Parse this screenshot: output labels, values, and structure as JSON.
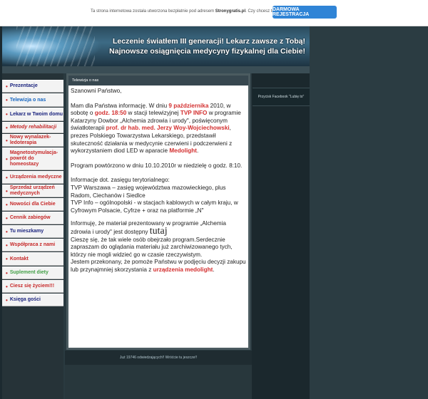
{
  "topbar": {
    "message_prefix": "Ta strona internetowa została utworzona bezpłatnie pod adresem ",
    "message_site": "Stronygratis.pl",
    "message_suffix": ". Czy chcesz też mieć własną stronę?",
    "register_label": "DARMOWA REJESTRACJA"
  },
  "banner": {
    "title": "Leczenie światłem III generacji! Lekarz zawsze z Tobą! Najnowsze osiągnięcia medycyny fizykalnej dla Ciebie!"
  },
  "nav": {
    "items": [
      {
        "label": "Prezentacje",
        "color": "#1a237e"
      },
      {
        "label": "Telewizja o nas",
        "color": "#1565c0"
      },
      {
        "label": "Lekarz w Twoim domu",
        "color": "#1a237e"
      },
      {
        "label": "Metody rehabilitacji",
        "color": "#c62828"
      },
      {
        "label": "Nowy wynalazek-ledoterapia",
        "color": "#c62828"
      },
      {
        "label": "Magnetostymulacja-powrót do homeostazy",
        "color": "#c62828"
      },
      {
        "label": "Urządzenia medyczne",
        "color": "#c62828"
      },
      {
        "label": "Sprzedaż urządzeń medycznych",
        "color": "#c62828"
      },
      {
        "label": "Nowości dla Ciebie",
        "color": "#c62828"
      },
      {
        "label": "Cennik zabiegów",
        "color": "#c62828"
      },
      {
        "label": "Tu mieszkamy",
        "color": "#1a237e"
      },
      {
        "label": "Współpraca z nami",
        "color": "#c62828"
      },
      {
        "label": "Kontakt",
        "color": "#c62828"
      },
      {
        "label": "Suplement diety",
        "color": "#43a047"
      },
      {
        "label": "Ciesz się życiem!!!",
        "color": "#c62828"
      },
      {
        "label": "Księga gości",
        "color": "#1a237e"
      }
    ]
  },
  "main": {
    "header": "Telewizja o nas",
    "greeting": "Szanowni Państwo,",
    "p1_a": "Mam dla Państwa informację. W dniu ",
    "p1_date": "9 października",
    "p1_b": " 2010, w sobotę o ",
    "p1_time": "godz. 18:50",
    "p1_c": " w stacji telewizyjnej ",
    "p1_tvp": "TVP INFO",
    "p1_d": " w programie Katarzyny Dowbor „Alchemia zdrowia i urody\", poświęconym światłoterapii ",
    "p1_prof": "prof. dr hab. med. Jerzy Woy-Wojciechowski",
    "p1_e": ", prezes Polskiego Towarzystwa Lekarskiego, przedstawił skuteczność działania w medycynie czerwieni i podczerwieni z wykorzystaniem diod LED w aparacie ",
    "p1_brand": "Medolight",
    "p1_end": ".",
    "p2": "Program powtórzono w dniu 10.10.2010r w niedzielę o godz. 8:10.",
    "p3_title": "Informacje dot. zasięgu terytorialnego:",
    "p3_a": "TVP Warszawa – zasięg województwa mazowieckiego, plus Radom, Ciechanów i Siedlce",
    "p3_b": "TVP Info – ogólnopolski - w stacjach kablowych w całym kraju, w Cyfrowym Polsacie, Cyfrze + oraz na platformie „N\"",
    "p4_a": "Informuję, że materiał prezentowany w programie „Alchemia zdrowia i urody\" jest dostępny ",
    "p4_big": "tutaj",
    "p5": "Cieszę się, że tak wiele osób obejrzało program.Serdecznie zapraszam do oglądania materiału już zarchiwizowanego tych, którzy nie mogli widzieć go w czasie rzeczywistym.",
    "p6_a": "Jestem przekonany, że pomoże Państwu w podjęciu decyzji zakupu lub przynajmniej skorzystania z ",
    "p6_link": "urządzenia medolight",
    "p6_end": "."
  },
  "footer": {
    "text": "Już 19746 odwiedzających!! Wróćcie tu jeszcze!!"
  },
  "sidebar_right": {
    "facebook_label": "Przycisk Facebook \"Lubię to\""
  }
}
